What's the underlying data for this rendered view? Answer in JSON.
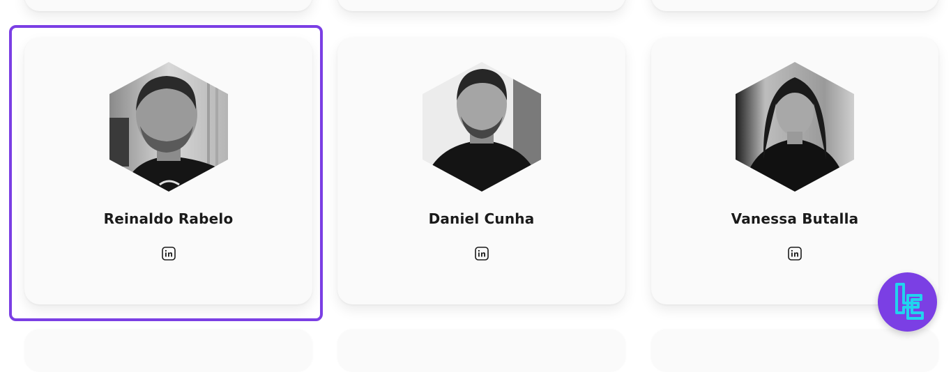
{
  "team": [
    {
      "name": "Reinaldo Rabelo",
      "linkedin_icon": "linkedin-icon",
      "highlighted": true
    },
    {
      "name": "Daniel Cunha",
      "linkedin_icon": "linkedin-icon",
      "highlighted": false
    },
    {
      "name": "Vanessa Butalla",
      "linkedin_icon": "linkedin-icon",
      "highlighted": false
    }
  ],
  "fab": {
    "icon": "tc-logo-icon",
    "color": "#7b3fe4",
    "accent": "#22d3ee"
  },
  "colors": {
    "highlight_border": "#7b3fe4",
    "card_bg": "#fafafa",
    "name_text": "#1a1a1a"
  }
}
